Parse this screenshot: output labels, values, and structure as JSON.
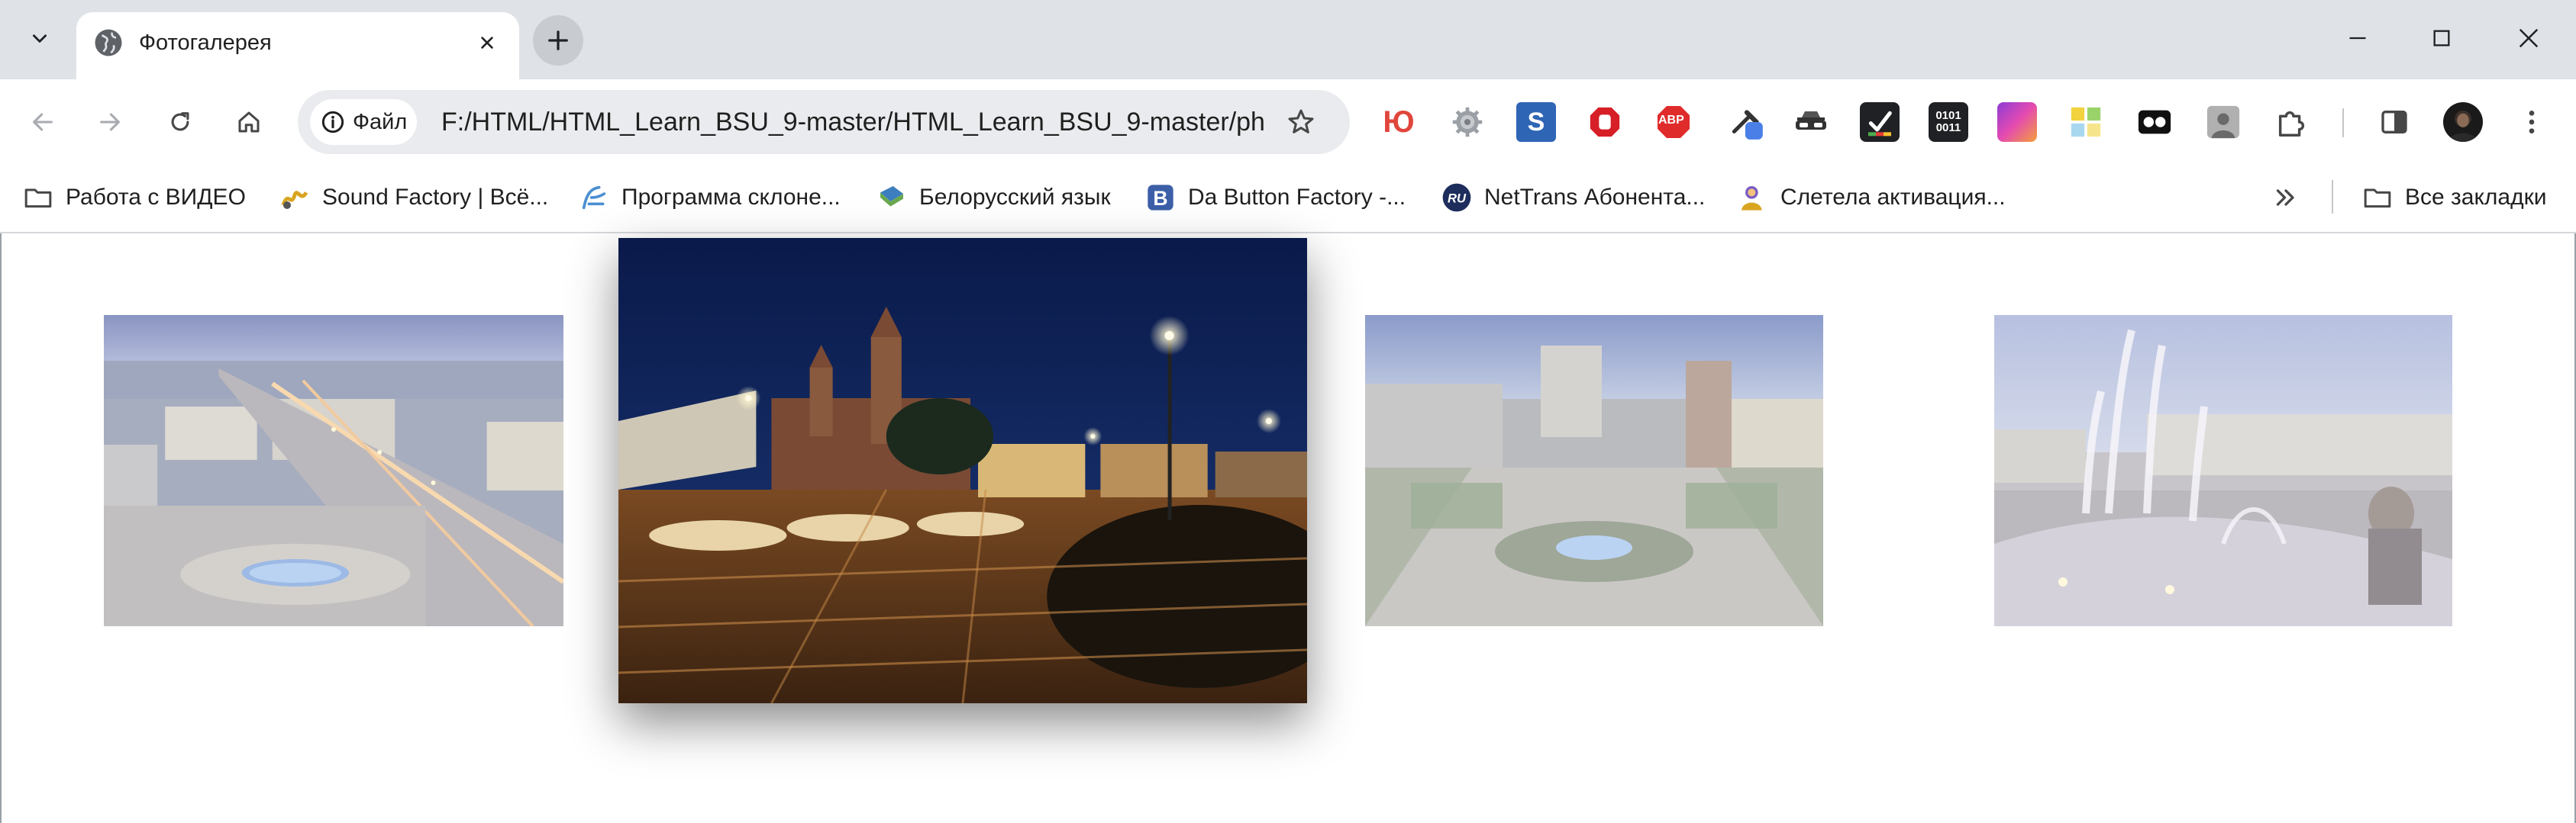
{
  "tab": {
    "title": "Фотогалерея"
  },
  "omnibox": {
    "chip_label": "Файл",
    "url": "F:/HTML/HTML_Learn_BSU_9-master/HTML_Learn_BSU_9-master/ph..."
  },
  "extensions": [
    {
      "name": "yu-extension-icon",
      "text": "Ю",
      "color": "#e0463c"
    },
    {
      "name": "settings-extension-icon",
      "text": "",
      "color": "#8a8f96"
    },
    {
      "name": "s-extension-icon",
      "text": "S",
      "color": "#2f65b5"
    },
    {
      "name": "stop-extension-icon",
      "text": "",
      "color": "#d61f26"
    },
    {
      "name": "abp-extension-icon",
      "text": "ABP",
      "color": "#e02b2b"
    },
    {
      "name": "eyedropper-extension-icon",
      "text": "",
      "color": "#4a7fe8"
    },
    {
      "name": "incognito-extension-icon",
      "text": "",
      "color": "#333333"
    },
    {
      "name": "checklist-extension-icon",
      "text": "",
      "color": "#202124"
    },
    {
      "name": "binary-extension-icon",
      "text": "0101 0011",
      "color": "#202124"
    },
    {
      "name": "gradient-extension-icon",
      "text": "",
      "color": "#d43fa7"
    },
    {
      "name": "tiles-extension-icon",
      "text": "",
      "color": "#e7c234"
    },
    {
      "name": "glasses-extension-icon",
      "text": "",
      "color": "#111111"
    },
    {
      "name": "profile-photo-extension-icon",
      "text": "",
      "color": "#888888"
    }
  ],
  "bookmarks": [
    {
      "name": "bookmark-video",
      "label": "Работа с ВИДЕО",
      "icon": "folder-icon"
    },
    {
      "name": "bookmark-sound-factory",
      "label": "Sound Factory | Всё...",
      "icon": "sound-factory-icon"
    },
    {
      "name": "bookmark-declension",
      "label": "Программа склоне...",
      "icon": "declension-icon"
    },
    {
      "name": "bookmark-belarusian",
      "label": "Белорусский язык",
      "icon": "book-icon"
    },
    {
      "name": "bookmark-button-factory",
      "label": "Da Button Factory -...",
      "icon": "b-icon"
    },
    {
      "name": "bookmark-nettrans",
      "label": "NetTrans Абонента...",
      "icon": "ru-icon"
    },
    {
      "name": "bookmark-activation",
      "label": "Слетела активация...",
      "icon": "person-icon"
    }
  ],
  "all_bookmarks_label": "Все закладки",
  "gallery": {
    "photos": [
      {
        "name": "photo-independence-avenue",
        "state": "dimmed"
      },
      {
        "name": "photo-independence-square-night",
        "state": "active"
      },
      {
        "name": "photo-square-dusk",
        "state": "dimmed"
      },
      {
        "name": "photo-fountain",
        "state": "dimmed"
      }
    ]
  }
}
